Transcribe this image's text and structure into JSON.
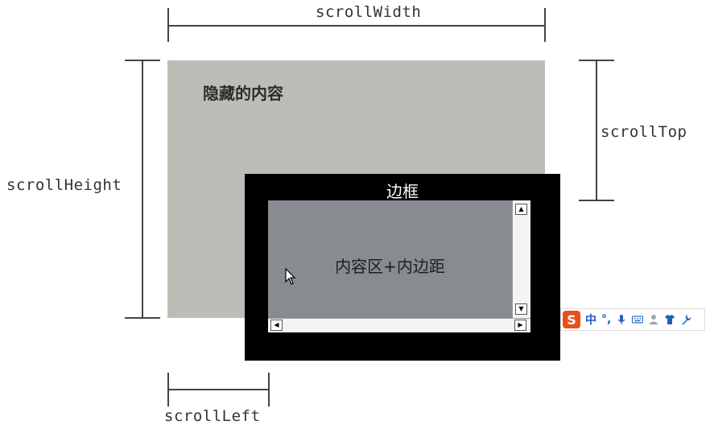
{
  "labels": {
    "scroll_width": "scrollWidth",
    "scroll_height": "scrollHeight",
    "scroll_top": "scrollTop",
    "scroll_left": "scrollLeft"
  },
  "regions": {
    "hidden_content": "隐藏的内容",
    "border": "边框",
    "content_padding": "内容区+内边距"
  },
  "ime_toolbar": {
    "logo": "S",
    "mode": "中",
    "punct": "°,",
    "icons": [
      "mic-icon",
      "keyboard-icon",
      "user-icon",
      "shirt-icon",
      "wrench-icon"
    ]
  },
  "colors": {
    "hidden_area": "#bdbcb6",
    "border": "#000000",
    "content_area": "#888c90",
    "ime_logo": "#e94e1b",
    "ime_accent": "#1f5fbf"
  }
}
